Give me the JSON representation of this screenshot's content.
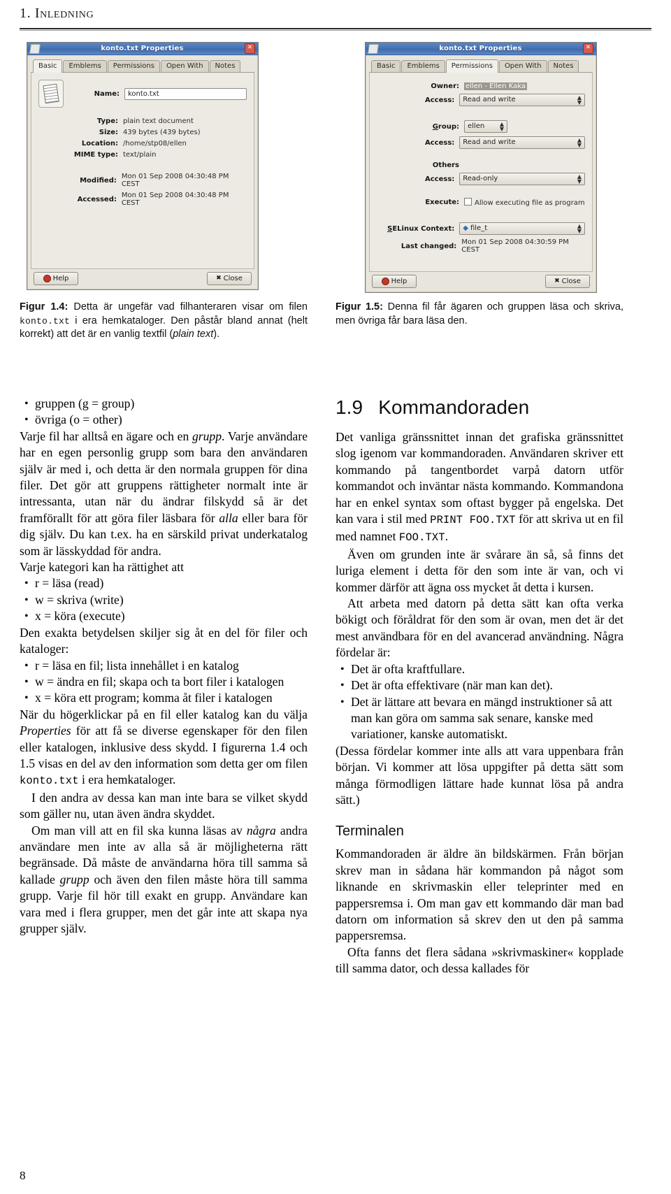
{
  "running_head": {
    "number": "1.",
    "title": "Inledning"
  },
  "page_number": "8",
  "figures": [
    {
      "id": "fig-1-4",
      "dialog": {
        "title": "konto.txt Properties",
        "close_label": "✕",
        "tabs": [
          "Basic",
          "Emblems",
          "Permissions",
          "Open With",
          "Notes"
        ],
        "active_tab": "Basic",
        "fields": [
          {
            "label": "Name:",
            "value": "konto.txt",
            "kind": "textbox"
          },
          {
            "label": "Type:",
            "value": "plain text document",
            "kind": "text"
          },
          {
            "label": "Size:",
            "value": "439 bytes (439 bytes)",
            "kind": "text"
          },
          {
            "label": "Location:",
            "value": "/home/stp08/ellen",
            "kind": "text"
          },
          {
            "label": "MIME type:",
            "value": "text/plain",
            "kind": "text"
          },
          {
            "label": "Modified:",
            "value": "Mon 01 Sep 2008 04:30:48 PM CEST",
            "kind": "text"
          },
          {
            "label": "Accessed:",
            "value": "Mon 01 Sep 2008 04:30:48 PM CEST",
            "kind": "text"
          }
        ],
        "help_button": "Help",
        "close_button": "Close"
      },
      "caption_label": "Figur 1.4:",
      "caption_parts": [
        {
          "t": " Detta är ungefär vad filhanteraren visar om filen "
        },
        {
          "t": "konto.txt",
          "s": "mono"
        },
        {
          "t": " i era hemkataloger. Den påstår bland annat (helt korrekt) att det är en vanlig textfil ("
        },
        {
          "t": "plain text",
          "s": "italic"
        },
        {
          "t": ")."
        }
      ]
    },
    {
      "id": "fig-1-5",
      "dialog": {
        "title": "konto.txt Properties",
        "close_label": "✕",
        "tabs": [
          "Basic",
          "Emblems",
          "Permissions",
          "Open With",
          "Notes"
        ],
        "active_tab": "Permissions",
        "rows": [
          {
            "label": "Owner:",
            "value": "ellen - Ellen Kaka",
            "kind": "highlight"
          },
          {
            "label": "Access:",
            "value": "Read and write",
            "kind": "combo-wide"
          },
          {
            "label": "Group:",
            "value": "ellen",
            "kind": "combo-small"
          },
          {
            "label": "Access:",
            "value": "Read and write",
            "kind": "combo-wide"
          },
          {
            "label": "Others",
            "value": "",
            "kind": "header"
          },
          {
            "label": "Access:",
            "value": "Read-only",
            "kind": "combo-wide"
          },
          {
            "label": "Execute:",
            "value": "Allow executing file as program",
            "kind": "checkbox"
          },
          {
            "label": "SELinux Context:",
            "value": "file_t",
            "kind": "combo-icon"
          },
          {
            "label": "Last changed:",
            "value": "Mon 01 Sep 2008 04:30:59 PM CEST",
            "kind": "text"
          }
        ],
        "help_button": "Help",
        "close_button": "Close"
      },
      "caption_label": "Figur 1.5:",
      "caption_parts": [
        {
          "t": " Denna fil får ägaren och gruppen läsa och skriva, men övriga får bara läsa den."
        }
      ]
    }
  ],
  "left_column": {
    "bullets_1": [
      "gruppen (g = group)",
      "övriga (o = other)"
    ],
    "para_1": [
      {
        "t": "Varje fil har alltså en ägare och en "
      },
      {
        "t": "grupp",
        "s": "italic"
      },
      {
        "t": ". Varje användare har en egen personlig grupp som bara den användaren själv är med i, och detta är den normala gruppen för dina filer. Det gör att gruppens rättigheter normalt inte är intressanta, utan när du ändrar filskydd så är det framförallt för att göra filer läsbara för "
      },
      {
        "t": "alla",
        "s": "italic"
      },
      {
        "t": " eller bara för dig själv. Du kan t.ex. ha en särskild privat underkatalog som är lässkyddad för andra."
      }
    ],
    "para_2": "Varje kategori kan ha rättighet att",
    "bullets_2": [
      "r = läsa (read)",
      "w = skriva (write)",
      "x = köra (execute)"
    ],
    "para_3": "Den exakta betydelsen skiljer sig åt en del för filer och kataloger:",
    "bullets_3": [
      "r = läsa en fil; lista innehållet i en katalog",
      "w = ändra en fil; skapa och ta bort filer i katalogen",
      "x = köra ett program; komma åt filer i katalogen"
    ],
    "para_4": [
      {
        "t": "När du högerklickar på en fil eller katalog kan du välja "
      },
      {
        "t": "Properties",
        "s": "italic"
      },
      {
        "t": " för att få se diverse egenskaper för den filen eller katalogen, inklusive dess skydd. I figurerna 1.4 och 1.5 visas en del av den information som detta ger om filen "
      },
      {
        "t": "konto.txt",
        "s": "mono"
      },
      {
        "t": " i era hemkataloger."
      }
    ],
    "para_5": "I den andra av dessa kan man inte bara se vilket skydd som gäller nu, utan även ändra skyddet.",
    "para_6": [
      {
        "t": "Om man vill att en fil ska kunna läsas av "
      },
      {
        "t": "några",
        "s": "italic"
      },
      {
        "t": " andra användare men inte av alla så är möjligheterna rätt begränsade. Då måste de användarna höra till samma så kallade "
      },
      {
        "t": "grupp",
        "s": "italic"
      },
      {
        "t": " och även den filen måste höra till samma grupp. Varje fil hör till exakt en grupp. Användare kan vara med i flera grupper, men det går inte att skapa nya grupper själv."
      }
    ]
  },
  "right_column": {
    "section": {
      "number": "1.9",
      "title": "Kommandoraden"
    },
    "para_1": [
      {
        "t": "Det vanliga gränssnittet innan det grafiska gränssnittet slog igenom var kommandoraden. Användaren skriver ett kommando på tangentbordet varpå datorn utför kommandot och inväntar nästa kommando. Kommandona har en enkel syntax som oftast bygger på engelska. Det kan vara i stil med "
      },
      {
        "t": "PRINT FOO.TXT",
        "s": "mono"
      },
      {
        "t": " för att skriva ut en fil med namnet "
      },
      {
        "t": "FOO.TXT",
        "s": "mono"
      },
      {
        "t": "."
      }
    ],
    "para_2": "Även om grunden inte är svårare än så, så finns det luriga element i detta för den som inte är van, och vi kommer därför att ägna oss mycket åt detta i kursen.",
    "para_3": "Att arbeta med datorn på detta sätt kan ofta verka bökigt och föråldrat för den som är ovan, men det är det mest användbara för en del avancerad användning. Några fördelar är:",
    "bullets": [
      "Det är ofta kraftfullare.",
      "Det är ofta effektivare (när man kan det).",
      "Det är lättare att bevara en mängd instruktioner så att man kan göra om samma sak senare, kanske med variationer, kanske automatiskt."
    ],
    "para_4": "(Dessa fördelar kommer inte alls att vara uppenbara från början. Vi kommer att lösa uppgifter på detta sätt som många förmodligen lättare hade kunnat lösa på andra sätt.)",
    "subsection": "Terminalen",
    "para_5": "Kommandoraden är äldre än bildskärmen. Från början skrev man in sådana här kommandon på något som liknande en skrivmaskin eller teleprinter med en pappersremsa i. Om man gav ett kommando där man bad datorn om information så skrev den ut den på samma pappersremsa.",
    "para_6": "Ofta fanns det flera sådana »skrivmaskiner« kopplade till samma dator, och dessa kallades för"
  }
}
